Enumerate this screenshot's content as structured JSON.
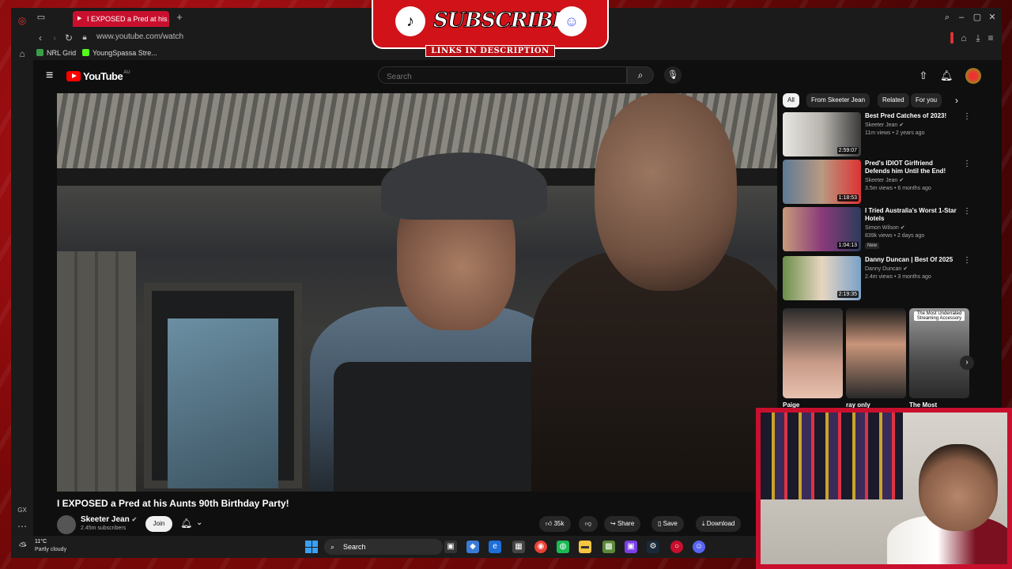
{
  "browser": {
    "tab_title": "I EXPOSED a Pred at his Au",
    "url": "www.youtube.com/watch",
    "bookmarks": [
      "NRL Grid",
      "YoungSpassa Stre..."
    ]
  },
  "youtube": {
    "logo_text": "YouTube",
    "logo_region": "AU",
    "search_placeholder": "Search"
  },
  "video": {
    "title": "I EXPOSED a Pred at his Aunts 90th Birthday Party!",
    "channel": "Skeeter Jean",
    "subscribers": "2.45m subscribers",
    "join_label": "Join",
    "actions": {
      "likes": "35k",
      "share": "Share",
      "save": "Save",
      "download": "Download"
    }
  },
  "chips": [
    "All",
    "From Skeeter Jean",
    "Related",
    "For you"
  ],
  "recommendations": [
    {
      "title": "Best Pred Catches of 2023!",
      "channel": "Skeeter Jean",
      "meta": "11m views • 2 years ago",
      "duration": "2:59:07",
      "badge": ""
    },
    {
      "title": "Pred's IDIOT Girlfriend Defends him Until the End!",
      "channel": "Skeeter Jean",
      "meta": "3.5m views • 6 months ago",
      "duration": "1:18:53",
      "badge": ""
    },
    {
      "title": "I Tried Australia's Worst 1-Star Hotels",
      "channel": "Simon Wilson",
      "meta": "839k views • 2 days ago",
      "duration": "1:04:13",
      "badge": "New"
    },
    {
      "title": "Danny Duncan | Best Of 2025",
      "channel": "Danny Duncan",
      "meta": "2.4m views • 3 months ago",
      "duration": "2:19:35",
      "badge": ""
    }
  ],
  "shorts": [
    {
      "label": "Paige",
      "overlay": ""
    },
    {
      "label": "ray only",
      "overlay": ""
    },
    {
      "label": "The Most",
      "overlay": "The Most Underrated Streaming Accessory"
    }
  ],
  "overlay": {
    "main": "SUBSCRIBE",
    "sub": "LINKS IN DESCRIPTION"
  },
  "taskbar": {
    "temp": "11°C",
    "weather": "Partly cloudy",
    "search_label": "Search"
  }
}
